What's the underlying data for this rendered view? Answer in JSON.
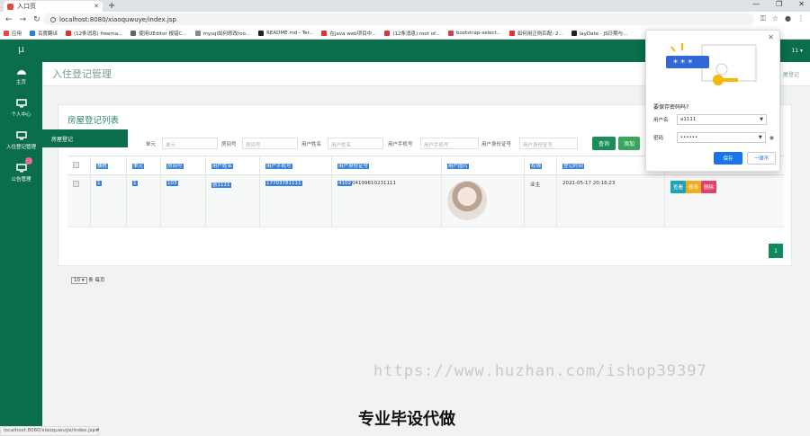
{
  "browser": {
    "tab_title": "入口页",
    "url": "localhost:8080/xiaoquwuye/index.jsp",
    "bookmarks": [
      "应用",
      "百度翻译",
      "(12条消息) freema...",
      "使用UEditor 报错C...",
      "mysql如何修改roo...",
      "README.md - Ter...",
      "在java web项目中...",
      "(12条消息) root of...",
      "bootstrap-select...",
      "如何用正则匹配: 2...",
      "layDate - JS日期与..."
    ]
  },
  "sidebar": {
    "logo": "μ",
    "items": [
      {
        "label": "主页"
      },
      {
        "label": "个人中心"
      },
      {
        "label": "入住登记管理"
      },
      {
        "label": "公告管理"
      }
    ],
    "submenu_item": "房屋登记"
  },
  "header": {
    "page_title": "入住登记管理",
    "user": "11 ▾",
    "breadcrumb": "屋登记"
  },
  "panel": {
    "title": "房屋登记列表",
    "filters": [
      {
        "label": "单元",
        "placeholder": "单元"
      },
      {
        "label": "房间号",
        "placeholder": "房间号"
      },
      {
        "label": "用户姓名",
        "placeholder": "用户姓名"
      },
      {
        "label": "用户手机号",
        "placeholder": "用户手机号"
      },
      {
        "label": "用户身份证号",
        "placeholder": "用户身份证号"
      }
    ],
    "query_btn": "查询",
    "add_btn": "添加"
  },
  "table": {
    "headers": [
      "楼栋",
      "单元",
      "房间号",
      "用户姓名",
      "用户手机号",
      "用户身份证号",
      "用户图片",
      "权限",
      "登记时间"
    ],
    "rows": [
      {
        "building": "1",
        "unit": "1",
        "room": "103",
        "name": "张1111",
        "phone": "17703781111",
        "id_sel": "4102",
        "id_rest": "04199610231111",
        "role": "业主",
        "time": "2021-05-17 20:16:23"
      }
    ],
    "actions": [
      "查看",
      "修改",
      "删除"
    ],
    "page_size": "10",
    "page_size_suffix": "条 每页",
    "page": "1"
  },
  "popup": {
    "question": "要保存密码吗?",
    "username_label": "用户名",
    "username": "a1111",
    "password_label": "密码",
    "password": "••••••",
    "save_btn": "保存",
    "never_btn": "一律不",
    "close": "✕",
    "illustration_text": "* * *"
  },
  "overlay": {
    "watermark": "https://www.huzhan.com/ishop39397",
    "caption": "专业毕设代做",
    "status_url": "localhost:8080/xiaoquwuye/index.jsp#"
  },
  "colors": {
    "primary": "#0a6d4b",
    "query_btn": "#1b8c5d",
    "add_btn": "#3aa55d",
    "view_btn": "#1fa2b8",
    "edit_btn": "#f0ad1a",
    "delete_btn": "#e5406b",
    "selection": "#3b82d9"
  }
}
